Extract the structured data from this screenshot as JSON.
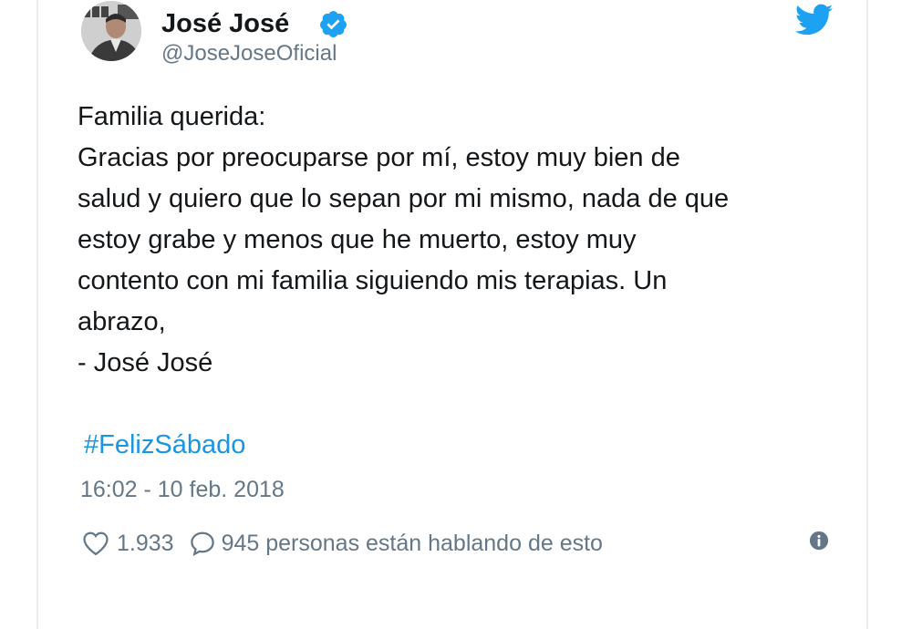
{
  "user": {
    "display_name": "José José",
    "handle": "@JoseJoseOficial",
    "verified": true
  },
  "tweet": {
    "lines": [
      "Familia querida:",
      "Gracias por preocuparse por mí, estoy muy bien de",
      "salud y quiero que lo sepan por mi mismo, nada de que",
      "estoy grabe y menos que he muerto, estoy muy",
      "contento con mi familia siguiendo mis terapias. Un",
      "abrazo,",
      "- José José"
    ],
    "hashtag": "#FelizSábado",
    "timestamp": "16:02 - 10 feb. 2018"
  },
  "actions": {
    "likes": "1.933",
    "talking": "945 personas están hablando de esto"
  },
  "icons": {
    "verified": "verified-badge-icon",
    "logo": "twitter-bird-icon",
    "like": "heart-icon",
    "reply": "speech-bubble-icon",
    "info": "info-icon"
  },
  "colors": {
    "brand": "#1da1f2",
    "link": "#1b95e0",
    "text": "#14171a",
    "muted": "#657786"
  }
}
